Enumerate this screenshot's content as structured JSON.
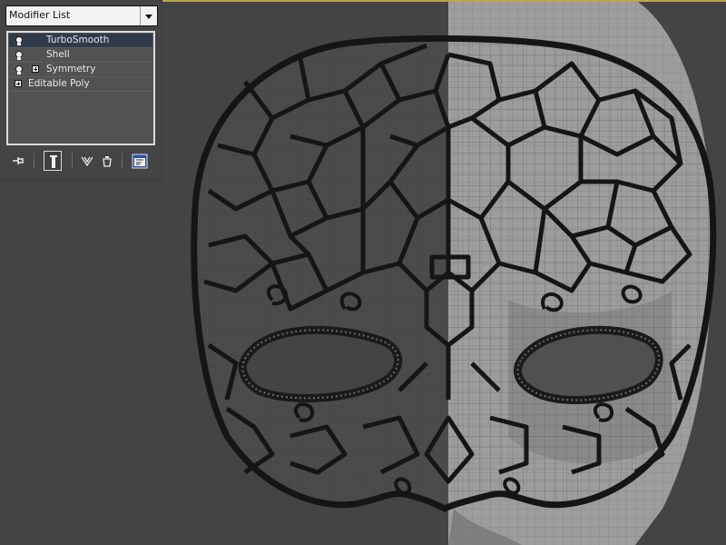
{
  "modifier_list": {
    "placeholder": "Modifier List"
  },
  "stack": [
    {
      "label": "TurboSmooth",
      "selected": true,
      "icon": "lightbulb-icon"
    },
    {
      "label": "Shell",
      "selected": false,
      "icon": "lightbulb-icon"
    },
    {
      "label": "Symmetry",
      "selected": false,
      "icon": "lightbulb-icon",
      "expand": "plus-icon"
    },
    {
      "label": "Editable Poly",
      "selected": false,
      "expand": "plus-icon"
    }
  ],
  "toolbar": [
    {
      "name": "pin-stack-icon"
    },
    {
      "name": "show-end-result-icon",
      "pressed": true
    },
    {
      "name": "make-unique-icon"
    },
    {
      "name": "remove-modifier-icon"
    },
    {
      "name": "configure-modifier-sets-icon"
    }
  ],
  "colors": {
    "viewport_bg": "#444444",
    "wire_dark": "#161616",
    "skin_light": "#a8a8a8",
    "skin_shadow": "#5a5a5a",
    "selected_row": "#2f3b4b",
    "active_viewport_border": "#b9a64a"
  }
}
